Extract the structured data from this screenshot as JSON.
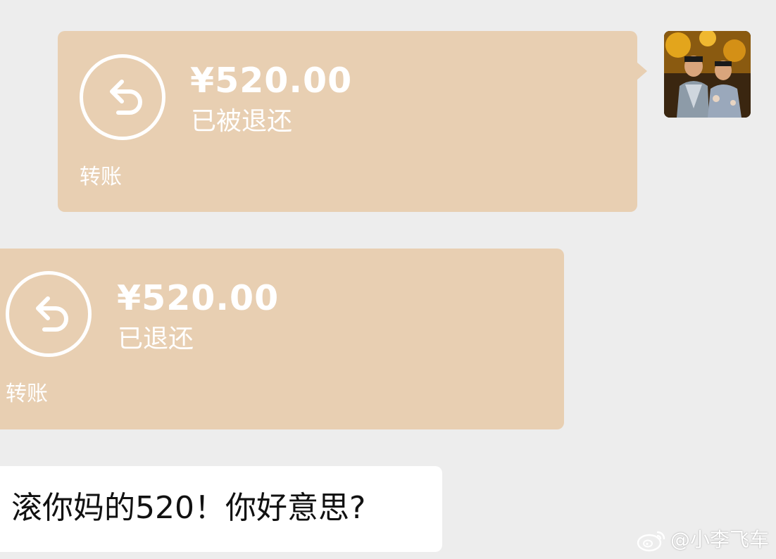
{
  "transfers": [
    {
      "direction": "sent",
      "amount": "¥520.00",
      "status": "已被退还",
      "caption": "转账",
      "icon": "refund-arrow-icon"
    },
    {
      "direction": "received",
      "amount": "¥520.00",
      "status": "已退还",
      "caption": "转账",
      "icon": "refund-arrow-icon"
    }
  ],
  "messages": [
    {
      "direction": "received",
      "text": "滚你妈的520！你好意思?"
    }
  ],
  "watermark": {
    "text": "@小李飞车",
    "icon": "weibo-logo-icon"
  },
  "colors": {
    "background": "#ededed",
    "transfer_bubble": "#e8cfb2",
    "text_bubble": "#ffffff"
  }
}
